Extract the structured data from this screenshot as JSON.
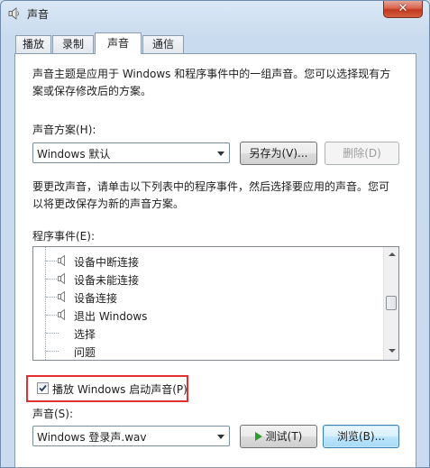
{
  "window": {
    "title": "声音"
  },
  "tabs": [
    {
      "label": "播放",
      "active": false
    },
    {
      "label": "录制",
      "active": false
    },
    {
      "label": "声音",
      "active": true
    },
    {
      "label": "通信",
      "active": false
    }
  ],
  "intro": {
    "line1": "声音主题是应用于 Windows 和程序事件中的一组声音。您可以选择现有方",
    "line2": "案或保存修改后的方案。"
  },
  "scheme": {
    "label": "声音方案(H):",
    "selected": "Windows 默认",
    "save_as_label": "另存为(V)...",
    "delete_label": "删除(D)"
  },
  "instructions": {
    "line1": "要更改声音，请单击以下列表中的程序事件，然后选择要应用的声音。您可",
    "line2": "以将更改保存为新的声音方案。"
  },
  "events": {
    "label": "程序事件(E):",
    "items": [
      {
        "label": "设备中断连接",
        "has_sound": true
      },
      {
        "label": "设备未能连接",
        "has_sound": true
      },
      {
        "label": "设备连接",
        "has_sound": true
      },
      {
        "label": "退出 Windows",
        "has_sound": true
      },
      {
        "label": "选择",
        "has_sound": false
      },
      {
        "label": "问题",
        "has_sound": false
      }
    ]
  },
  "startup": {
    "label": "播放 Windows 启动声音(P)",
    "checked": true
  },
  "sound": {
    "label": "声音(S):",
    "selected": "Windows 登录声.wav",
    "test_label": "测试(T)",
    "browse_label": "浏览(B)..."
  },
  "colors": {
    "highlight_box": "#e23030",
    "test_icon": "#2e9b2e"
  },
  "icons": {
    "app": "speaker-icon",
    "event": "speaker-icon",
    "test": "play-icon",
    "check": "checkmark-icon"
  }
}
